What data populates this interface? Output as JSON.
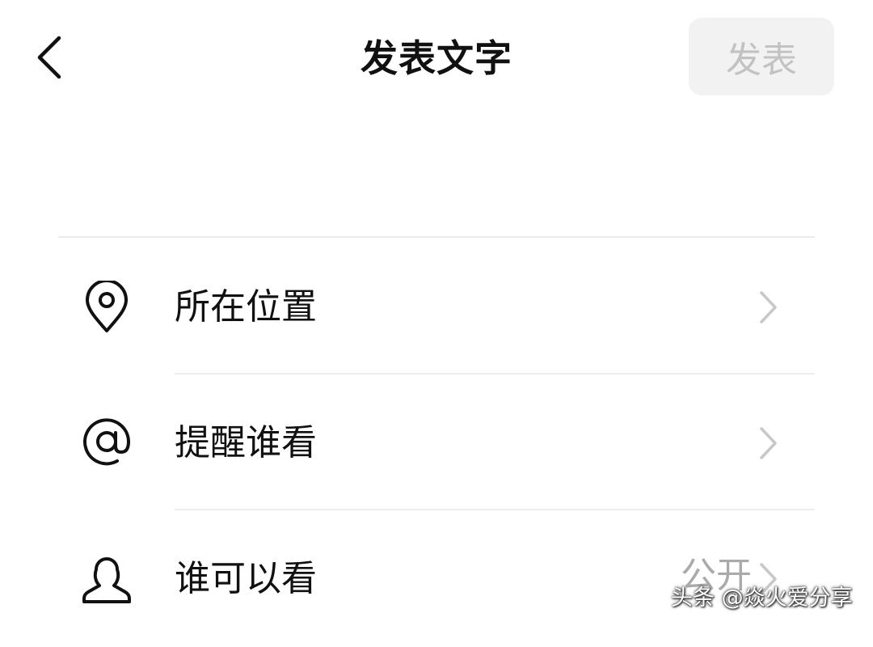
{
  "header": {
    "title": "发表文字",
    "publish_label": "发表"
  },
  "rows": [
    {
      "label": "所在位置",
      "icon": "location-pin-icon"
    },
    {
      "label": "提醒谁看",
      "icon": "at-sign-icon"
    },
    {
      "label": "谁可以看",
      "icon": "person-icon",
      "value": "公开"
    }
  ],
  "watermark": "头条 @焱火爱分享",
  "colors": {
    "publish_bg": "#f2f2f2",
    "publish_text": "#c2c2c2",
    "divider": "#ececec",
    "chevron": "#c8c8c8",
    "value_text": "#aaaaaa"
  }
}
